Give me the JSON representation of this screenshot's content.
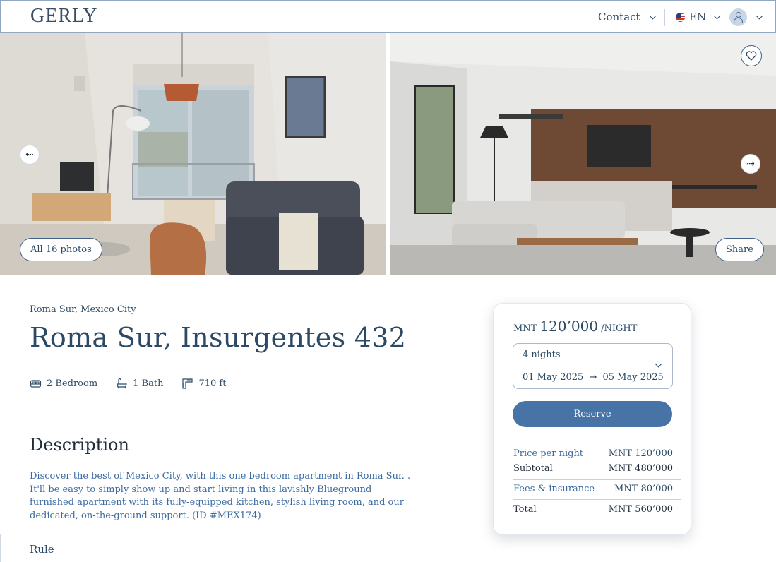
{
  "header": {
    "logo": "GERLY",
    "contact_label": "Contact",
    "language": "EN"
  },
  "gallery": {
    "all_photos_label": "All 16 photos",
    "share_label": "Share",
    "prev_icon": "arrow-left-icon",
    "next_icon": "arrow-right-icon",
    "favorite_icon": "heart-icon"
  },
  "listing": {
    "location": "Roma Sur, Mexico City",
    "title": "Roma Sur, Insurgentes 432",
    "features": [
      {
        "icon": "bed-icon",
        "label": "2 Bedroom"
      },
      {
        "icon": "bath-icon",
        "label": "1 Bath"
      },
      {
        "icon": "ruler-icon",
        "label": "710 ft"
      }
    ],
    "description_title": "Description",
    "description": "Discover the best of Mexico City, with this one bedroom apartment in Roma Sur. . It'll be easy to simply show up and start living in this lavishly Blueground furnished apartment with its fully-equipped kitchen, stylish living room, and our dedicated, on-the-ground support. (ID #MEX174)",
    "rule_title": "Rule"
  },
  "booking": {
    "currency": "MNT",
    "price": "120’000",
    "per_night": "/NIGHT",
    "nights": "4 nights",
    "check_in": "01 May 2025",
    "arrow": "→",
    "check_out": "05 May 2025",
    "reserve_label": "Reserve",
    "lines": [
      {
        "label": "Price per night",
        "value": "MNT 120’000"
      },
      {
        "label": "Subtotal",
        "value": "MNT 480’000"
      },
      {
        "label": "Fees & insurance",
        "value": "MNT 80’000"
      },
      {
        "label": "Total",
        "value": "MNT 560’000"
      }
    ]
  },
  "colors": {
    "accent": "#4773a7",
    "text": "#2c4a66",
    "link_text": "#3b6aa0"
  }
}
